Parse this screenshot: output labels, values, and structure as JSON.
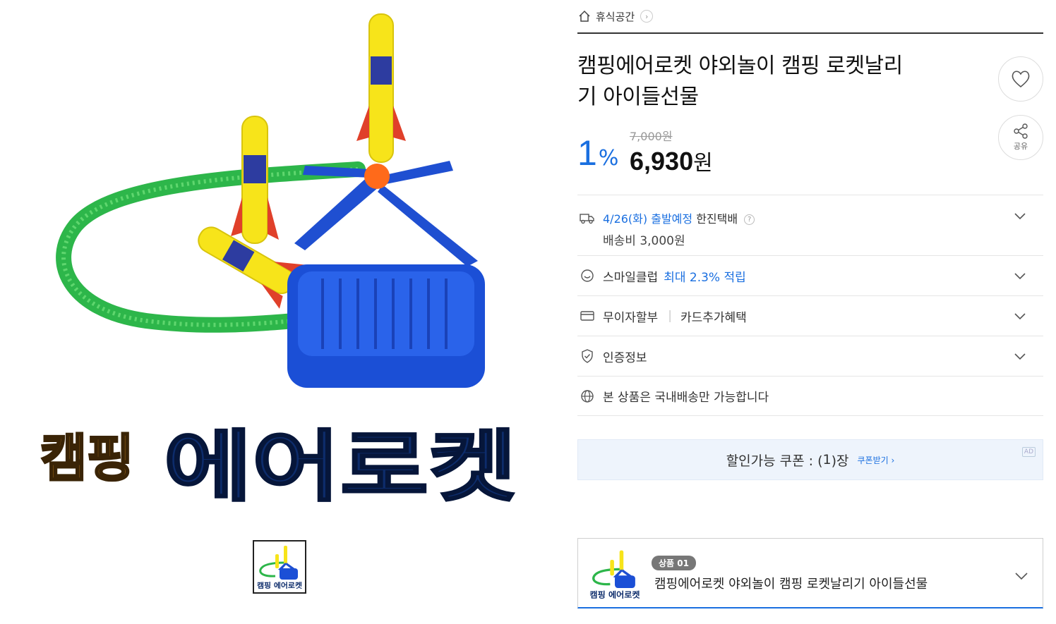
{
  "breadcrumb": {
    "category": "휴식공간",
    "home_icon": "home-icon",
    "chevron": "›"
  },
  "product": {
    "title_line1": "캠핑에어로켓 야외놀이 캠핑 로켓날리",
    "title_line2": "기 아이들선물",
    "image_caption_left": "캠핑",
    "image_caption_right": "에어로켓",
    "thumb_caption": "캠핑 에어로켓"
  },
  "actions": {
    "wish_icon": "heart-icon",
    "share_icon": "share-icon",
    "share_label": "공유"
  },
  "price": {
    "original": "7,000원",
    "discount_num": "1",
    "discount_unit": "%",
    "sale_amount": "6,930",
    "sale_unit": "원"
  },
  "shipping": {
    "date": "4/26(화) 출발예정",
    "carrier": "한진택배",
    "help": "?",
    "fee": "배송비 3,000원"
  },
  "smile": {
    "label": "스마일클럽",
    "benefit": "최대 2.3% 적립"
  },
  "card": {
    "label": "무이자할부",
    "divider": "|",
    "extra": "카드추가혜택"
  },
  "cert": {
    "label": "인증정보"
  },
  "domestic": {
    "label": "본 상품은 국내배송만 가능합니다"
  },
  "coupon": {
    "text_prefix": "할인가능 쿠폰 : (",
    "count": "1",
    "text_suffix": ")장",
    "link": "쿠폰받기 ›",
    "ad": "AD"
  },
  "option": {
    "badge": "상품 01",
    "name": "캠핑에어로켓 야외놀이 캠핑 로켓날리기 아이들선물"
  },
  "colors": {
    "accent": "#1a6fe0",
    "coupon_bg": "#eef4fc",
    "caption_brown": "#8a5a14",
    "caption_navy": "#0d2c6b"
  }
}
